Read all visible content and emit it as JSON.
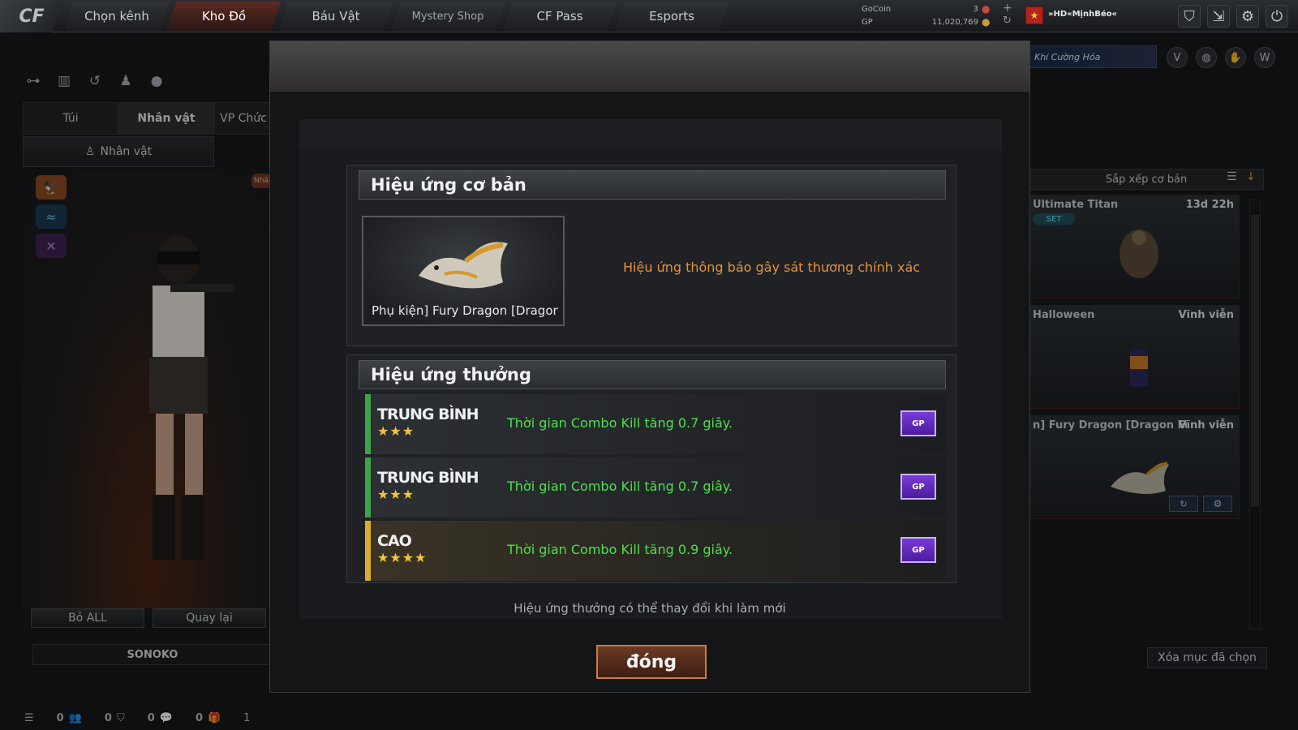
{
  "nav": {
    "logo": "CF",
    "tabs": [
      {
        "label": "Chọn kênh"
      },
      {
        "label": "Kho Đồ"
      },
      {
        "label": "Báu Vật"
      },
      {
        "label": "Mystery Shop"
      },
      {
        "label": "CF Pass"
      },
      {
        "label": "Esports"
      }
    ]
  },
  "currency": {
    "gocoin_label": "GoCoin",
    "gocoin_value": "3",
    "gp_label": "GP",
    "gp_value": "11,020,769"
  },
  "player": {
    "name": "»HD«MịnhBéo«"
  },
  "left": {
    "tabs": [
      "Túi",
      "Nhân vật",
      "VP Chức"
    ],
    "character_button": "Nhân vật",
    "side_tag": "Nhâ",
    "reset_all": "Bỏ ALL",
    "back": "Quay lại",
    "character_name": "SONOKO"
  },
  "statusbar": {
    "items": [
      "0",
      "0",
      "0",
      "0",
      "1"
    ]
  },
  "right": {
    "promo": "Khí Cường Hóa",
    "sort_label": "Sắp xếp cơ bản",
    "items": [
      {
        "name": "Ultimate Titan",
        "duration": "13d 22h",
        "badge": "SET"
      },
      {
        "name": "Halloween",
        "duration": "Vĩnh viễn"
      },
      {
        "name": "n] Fury Dragon [Dragon Fury]",
        "duration": "Vĩnh viễn"
      }
    ],
    "clear_selected": "Xóa mục đã chọn"
  },
  "modal": {
    "basic_title": "Hiệu ứng cơ bản",
    "item_name": "Phụ kiện] Fury Dragon [Dragon Fury]",
    "basic_effect": "Hiệu ứng thông báo gây sát thương chính xác",
    "bonus_title": "Hiệu ứng thưởng",
    "bonus_rows": [
      {
        "tier": "TRUNG BÌNH",
        "stars": "★★★",
        "text": "Thời gian Combo Kill tăng 0.7 giây.",
        "color": "#3fa34a"
      },
      {
        "tier": "TRUNG BÌNH",
        "stars": "★★★",
        "text": "Thời gian Combo Kill tăng 0.7 giây.",
        "color": "#3fa34a"
      },
      {
        "tier": "CAO",
        "stars": "★★★★",
        "text": "Thời gian Combo Kill tăng 0.9 giây.",
        "color": "#d9ae2e"
      }
    ],
    "gp_icon": "GP",
    "note": "Hiệu ứng thưởng có thể thay đổi khi làm mới",
    "close_label": "đóng"
  }
}
